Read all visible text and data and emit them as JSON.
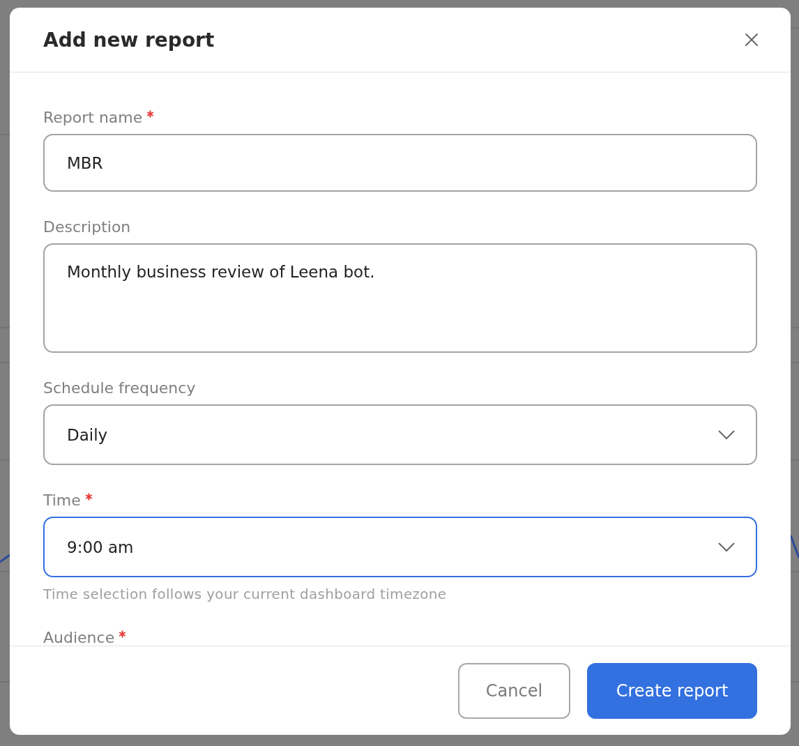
{
  "dialog": {
    "title": "Add new report",
    "fields": [
      {
        "kind": "text",
        "label": "Report name",
        "required": true,
        "focused": false,
        "value": "MBR"
      },
      {
        "kind": "textarea",
        "label": "Description",
        "required": false,
        "focused": false,
        "value": "Monthly business review of Leena bot."
      },
      {
        "kind": "select",
        "label": "Schedule frequency",
        "required": false,
        "focused": false,
        "value": "Daily"
      },
      {
        "kind": "select",
        "label": "Time",
        "required": true,
        "focused": true,
        "value": "9:00 am",
        "hint": "Time selection follows your current dashboard timezone"
      },
      {
        "kind": "cut",
        "label": "Audience",
        "required": true
      }
    ],
    "buttons": [
      {
        "kind": "secondary",
        "label": "Cancel"
      },
      {
        "kind": "primary",
        "label": "Create report"
      }
    ]
  }
}
